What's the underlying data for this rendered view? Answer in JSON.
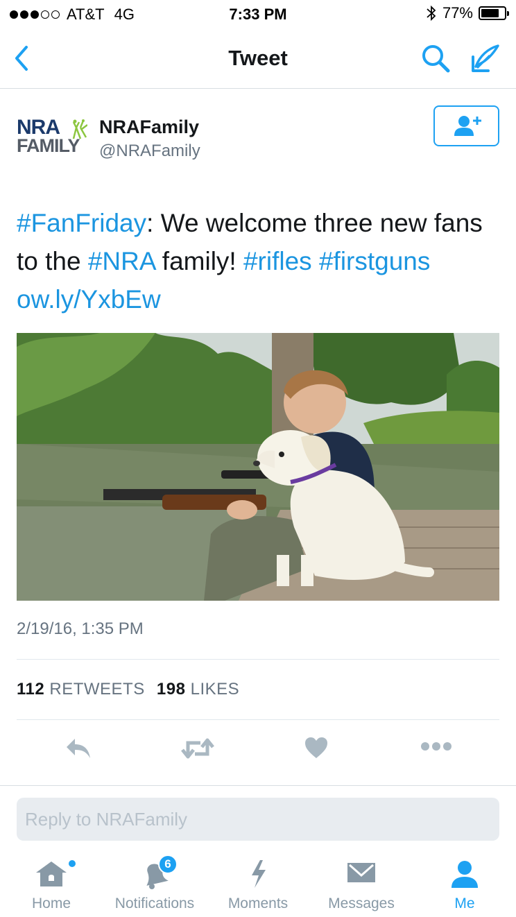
{
  "status_bar": {
    "carrier": "AT&T",
    "network": "4G",
    "time": "7:33 PM",
    "battery": "77%",
    "battery_level": 0.77,
    "signal_bars_filled": 3,
    "signal_bars_total": 5
  },
  "nav": {
    "title": "Tweet",
    "back_icon": "chevron-left-icon",
    "search_icon": "search-icon",
    "compose_icon": "compose-icon"
  },
  "tweet": {
    "logo_line1": "NRA",
    "logo_line2": "FAMILY",
    "user_name": "NRAFamily",
    "user_handle": "@NRAFamily",
    "follow_icon": "add-user-icon",
    "text_parts": {
      "hashtag1": "#FanFriday",
      "text1": ": We welcome three new fans to the ",
      "hashtag2": "#NRA",
      "text2": " family! ",
      "hashtag3": "#rifles",
      "hashtag4": "#firstguns",
      "link": "ow.ly/YxbEw"
    },
    "timestamp": "2/19/16, 1:35 PM",
    "retweet_count": "112",
    "retweet_label": "RETWEETS",
    "like_count": "198",
    "like_label": "LIKES"
  },
  "actions": {
    "reply_icon": "reply-icon",
    "retweet_icon": "retweet-icon",
    "like_icon": "heart-icon",
    "more_icon": "more-icon"
  },
  "reply": {
    "placeholder": "Reply to NRAFamily"
  },
  "tabs": [
    {
      "label": "Home",
      "icon": "home-icon"
    },
    {
      "label": "Notifications",
      "icon": "bell-icon",
      "badge": "6"
    },
    {
      "label": "Moments",
      "icon": "lightning-icon"
    },
    {
      "label": "Messages",
      "icon": "envelope-icon"
    },
    {
      "label": "Me",
      "icon": "person-icon",
      "active": true
    }
  ],
  "colors": {
    "accent": "#1da1f2",
    "link": "#1b95e0",
    "muted": "#8899a6",
    "icon_gray": "#aab8c2"
  }
}
